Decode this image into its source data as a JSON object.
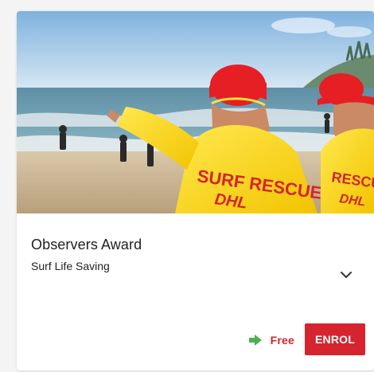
{
  "card": {
    "title": "Observers Award",
    "subtitle": "Surf Life Saving",
    "price_label": "Free",
    "enrol_label": "ENROL",
    "hero_image": {
      "alt": "Surf lifesavers in red caps and yellow shirts on a beach",
      "shirt_text_primary": "SURF RESCUE",
      "shirt_text_secondary": "DHL",
      "shirt_text_partial": "RESCUE",
      "shirt_text_partial_secondary": "DHL"
    },
    "icons": {
      "expand": "chevron-down-icon",
      "price": "arrow-right-icon"
    }
  },
  "colors": {
    "accent": "#d6242f",
    "price_icon": "#4caf50",
    "card_background": "#ffffff",
    "page_background": "#f4f4f4"
  }
}
